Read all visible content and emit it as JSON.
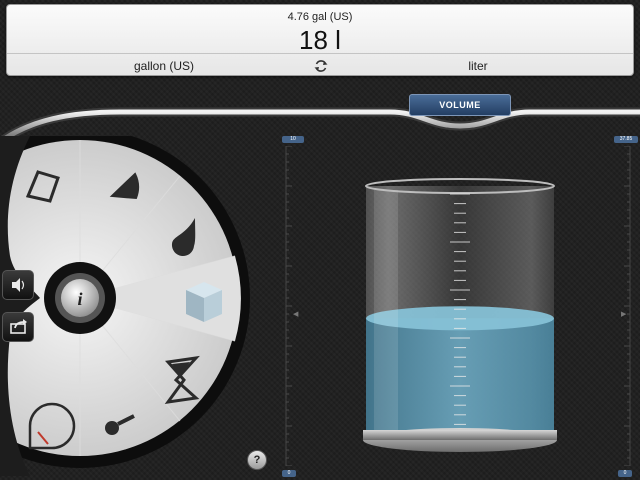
{
  "display": {
    "source_value": "4.76 gal (US)",
    "result": "18 l",
    "unit_from": "gallon (US)",
    "unit_to": "liter"
  },
  "category_badge": "VOLUME",
  "left_scale": {
    "top_label": "10",
    "bottom_label": "0"
  },
  "right_scale": {
    "top_label": "37.85",
    "bottom_label": "0"
  },
  "beaker": {
    "fill_fraction": 0.475,
    "liquid_color": "#5d9bb5"
  },
  "wheel": {
    "items": [
      "area-icon",
      "angle-icon",
      "drop-icon",
      "cube-icon",
      "hourglass-icon",
      "thermometer-icon",
      "speed-icon"
    ],
    "selected": "cube-icon"
  },
  "help_label": "?",
  "colors": {
    "accent": "#45648a",
    "background": "#1d1d1d"
  }
}
